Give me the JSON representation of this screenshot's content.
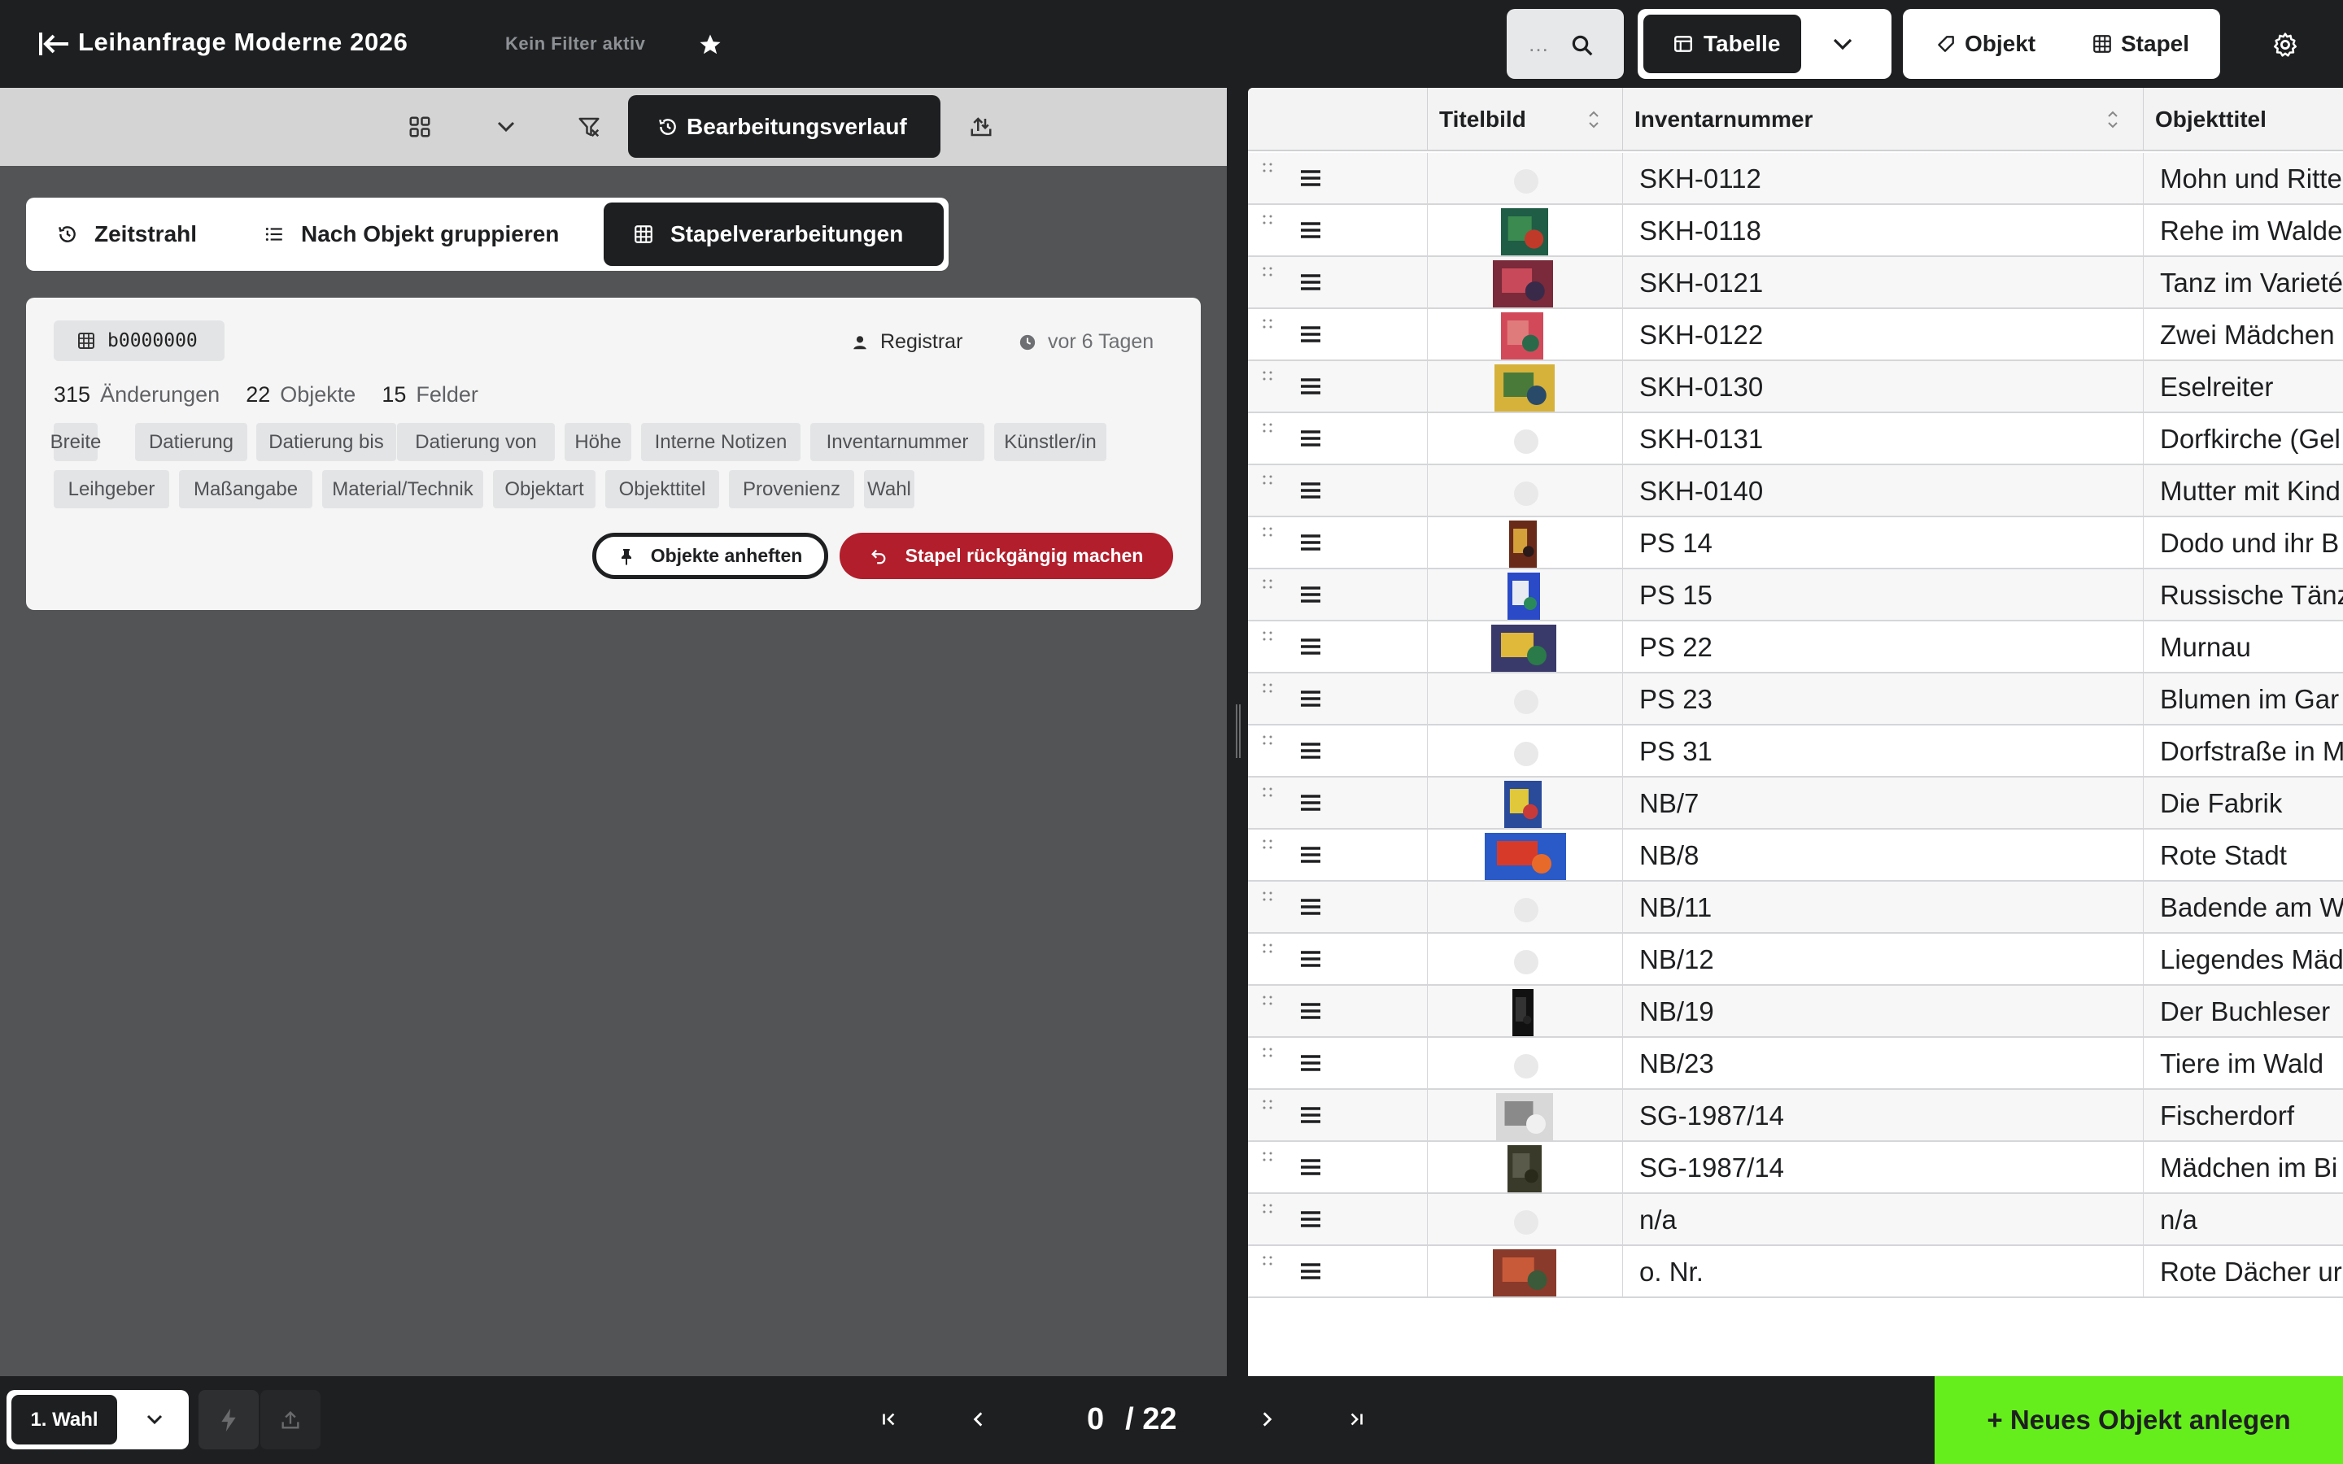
{
  "header": {
    "project_title": "Leihanfrage Moderne 2026",
    "filter_status": "Kein Filter aktiv",
    "search_placeholder": "…",
    "view_label": "Tabelle",
    "mode_object": "Objekt",
    "mode_batch": "Stapel"
  },
  "toolbar": {
    "history_label": "Bearbeitungsverlauf"
  },
  "tabs": [
    {
      "label": "Zeitstrahl",
      "icon": "history-icon"
    },
    {
      "label": "Nach Objekt gruppieren",
      "icon": "list-icon"
    },
    {
      "label": "Stapelverarbeitungen",
      "icon": "grid-icon",
      "active": true
    }
  ],
  "batch": {
    "id": "b0000000",
    "user": "Registrar",
    "time": "vor 6 Tagen",
    "changes_count": "315",
    "changes_label": "Änderungen",
    "objects_count": "22",
    "objects_label": "Objekte",
    "fields_count": "15",
    "fields_label": "Felder",
    "fields": [
      "Breite",
      "Datierung",
      "Datierung bis",
      "Datierung von",
      "Höhe",
      "Interne Notizen",
      "Inventarnummer",
      "Künstler/in",
      "Leihgeber",
      "Maßangabe",
      "Material/Technik",
      "Objektart",
      "Objekttitel",
      "Provenienz",
      "Wahl"
    ],
    "pin_label": "Objekte anheften",
    "undo_label": "Stapel rückgängig machen",
    "undo_color": "#b21e2b"
  },
  "table": {
    "columns": [
      "Titelbild",
      "Inventarnummer",
      "Objekttitel"
    ],
    "rows": [
      {
        "inv": "SKH-0112",
        "title": "Mohn und Ritte",
        "img": null
      },
      {
        "inv": "SKH-0118",
        "title": "Rehe im Walde",
        "img": "forest-green"
      },
      {
        "inv": "SKH-0121",
        "title": "Tanz im Varieté",
        "img": "dance-red"
      },
      {
        "inv": "SKH-0122",
        "title": "Zwei Mädchen",
        "img": "girls-red"
      },
      {
        "inv": "SKH-0130",
        "title": "Eselreiter",
        "img": "donkey-yellow"
      },
      {
        "inv": "SKH-0131",
        "title": "Dorfkirche (Gel",
        "img": null
      },
      {
        "inv": "SKH-0140",
        "title": "Mutter mit Kind",
        "img": null
      },
      {
        "inv": "PS 14",
        "title": "Dodo und ihr B",
        "img": "dodo-dark"
      },
      {
        "inv": "PS 15",
        "title": "Russische Tänz",
        "img": "dancer-blue"
      },
      {
        "inv": "PS 22",
        "title": "Murnau",
        "img": "murnau-mountain"
      },
      {
        "inv": "PS 23",
        "title": "Blumen im Gar",
        "img": null
      },
      {
        "inv": "PS 31",
        "title": "Dorfstraße in M",
        "img": null
      },
      {
        "inv": "NB/7",
        "title": "Die Fabrik",
        "img": "factory-blue"
      },
      {
        "inv": "NB/8",
        "title": "Rote Stadt",
        "img": "city-red"
      },
      {
        "inv": "NB/11",
        "title": "Badende am W",
        "img": null
      },
      {
        "inv": "NB/12",
        "title": "Liegendes Mäd",
        "img": null
      },
      {
        "inv": "NB/19",
        "title": "Der Buchleser",
        "img": "sculpture-black"
      },
      {
        "inv": "NB/23",
        "title": "Tiere im Wald",
        "img": null
      },
      {
        "inv": "SG-1987/14",
        "title": "Fischerdorf",
        "img": "sketch-grey"
      },
      {
        "inv": "SG-1987/14",
        "title": "Mädchen im Bi",
        "img": "girl-dark"
      },
      {
        "inv": "n/a",
        "title": "n/a",
        "img": null
      },
      {
        "inv": "o. Nr.",
        "title": "Rote Dächer ur",
        "img": "roofs-red"
      }
    ]
  },
  "footer": {
    "selection_label": "1. Wahl",
    "page_current": "0",
    "page_total": "/ 22",
    "new_object_label": "+ Neues Objekt anlegen",
    "new_object_color": "#65ee1b"
  }
}
